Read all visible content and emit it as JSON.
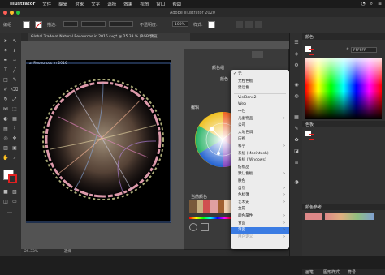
{
  "menubar": {
    "app": "Illustrator",
    "items": [
      "文件",
      "编辑",
      "对象",
      "文字",
      "选择",
      "效果",
      "视图",
      "窗口",
      "帮助"
    ]
  },
  "window": {
    "title": "Adobe Illustrator 2020"
  },
  "control": {
    "group_label": "编组",
    "stroke_label": "描边:",
    "stroke_value": "",
    "style_label": "不透明度:",
    "opacity_value": "100%",
    "style2_label": "样式:"
  },
  "document": {
    "tab_title": "Global Trade of Natural Resources in 2016.svg* @ 25.33 % (RGB/预览)",
    "artboard_title": "ral Resources in 2016",
    "zoom": "25.33%",
    "status_mode": "选择"
  },
  "guide_panel": {
    "harmony_label": "颜色组",
    "color_label": "颜色",
    "edit_label": "编辑",
    "current_label": "当前颜色",
    "pick_label": "颜色组"
  },
  "dropdown": {
    "items": [
      {
        "label": "无",
        "checked": true
      },
      {
        "label": "文档色板"
      },
      {
        "label": "建议色"
      },
      {
        "sep": true
      },
      {
        "label": "VisiBone2"
      },
      {
        "label": "Web"
      },
      {
        "label": "中性"
      },
      {
        "label": "儿童物品",
        "arrow": true
      },
      {
        "label": "公司"
      },
      {
        "label": "大地色调"
      },
      {
        "label": "庆祝"
      },
      {
        "label": "科学",
        "arrow": true
      },
      {
        "label": "系统 (Macintosh)"
      },
      {
        "label": "系统 (Windows)"
      },
      {
        "label": "纺织品"
      },
      {
        "label": "默认色板",
        "arrow": true
      },
      {
        "label": "肤色"
      },
      {
        "label": "自然",
        "arrow": true
      },
      {
        "label": "色标簿",
        "arrow": true
      },
      {
        "label": "艺术史",
        "arrow": true
      },
      {
        "label": "金属"
      },
      {
        "label": "颜色属性",
        "arrow": true
      },
      {
        "label": "食品",
        "arrow": true
      },
      {
        "label": "渐变",
        "arrow": true,
        "highlight": true
      },
      {
        "label": "用户定义",
        "arrow": true,
        "disabled": true
      }
    ]
  },
  "right_panel": {
    "color_title": "颜色",
    "hex_value": "FFFFFF",
    "swatches_title": "色板",
    "guide_title": "颜色参考",
    "tab1": "画笔",
    "tab2": "图形样式",
    "tab3": "符号"
  },
  "colors": {
    "accent": "#3b7ce3",
    "chrome": "#323232",
    "canvas": "#535353"
  }
}
